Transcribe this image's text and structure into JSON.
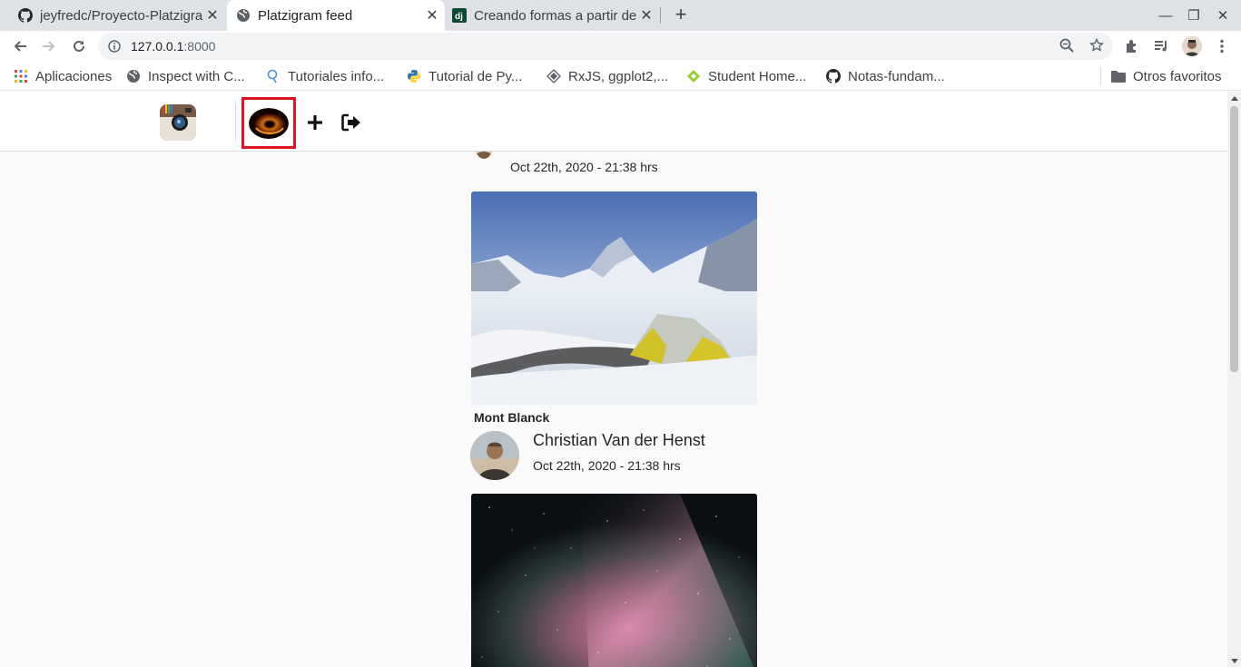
{
  "tabs": [
    {
      "title": "jeyfredc/Proyecto-Platzigram",
      "close": "✕"
    },
    {
      "title": "Platzigram feed",
      "close": "✕"
    },
    {
      "title": "Creando formas a partir de modelos",
      "close": "✕"
    }
  ],
  "new_tab": "+",
  "window": {
    "minimize": "—",
    "restore": "❐",
    "close": "✕"
  },
  "address": {
    "host": "127.0.0.1",
    "port": ":8000"
  },
  "bookmarks": [
    {
      "label": "Aplicaciones"
    },
    {
      "label": "Inspect with C..."
    },
    {
      "label": "Tutoriales info..."
    },
    {
      "label": "Tutorial de Py..."
    },
    {
      "label": "RxJS, ggplot2,..."
    },
    {
      "label": "Student Home..."
    },
    {
      "label": "Notas-fundam..."
    }
  ],
  "other_bookmarks": "Otros favoritos",
  "feed": {
    "post1": {
      "date": "Oct 22th, 2020 - 21:38 hrs",
      "title": "Mont Blanck"
    },
    "post2": {
      "author": "Christian Van der Henst",
      "date": "Oct 22th, 2020 - 21:38 hrs"
    }
  },
  "colors": {
    "highlight": "#e0141b",
    "tabstrip": "#dee1e6",
    "page_bg": "#fafafa"
  }
}
